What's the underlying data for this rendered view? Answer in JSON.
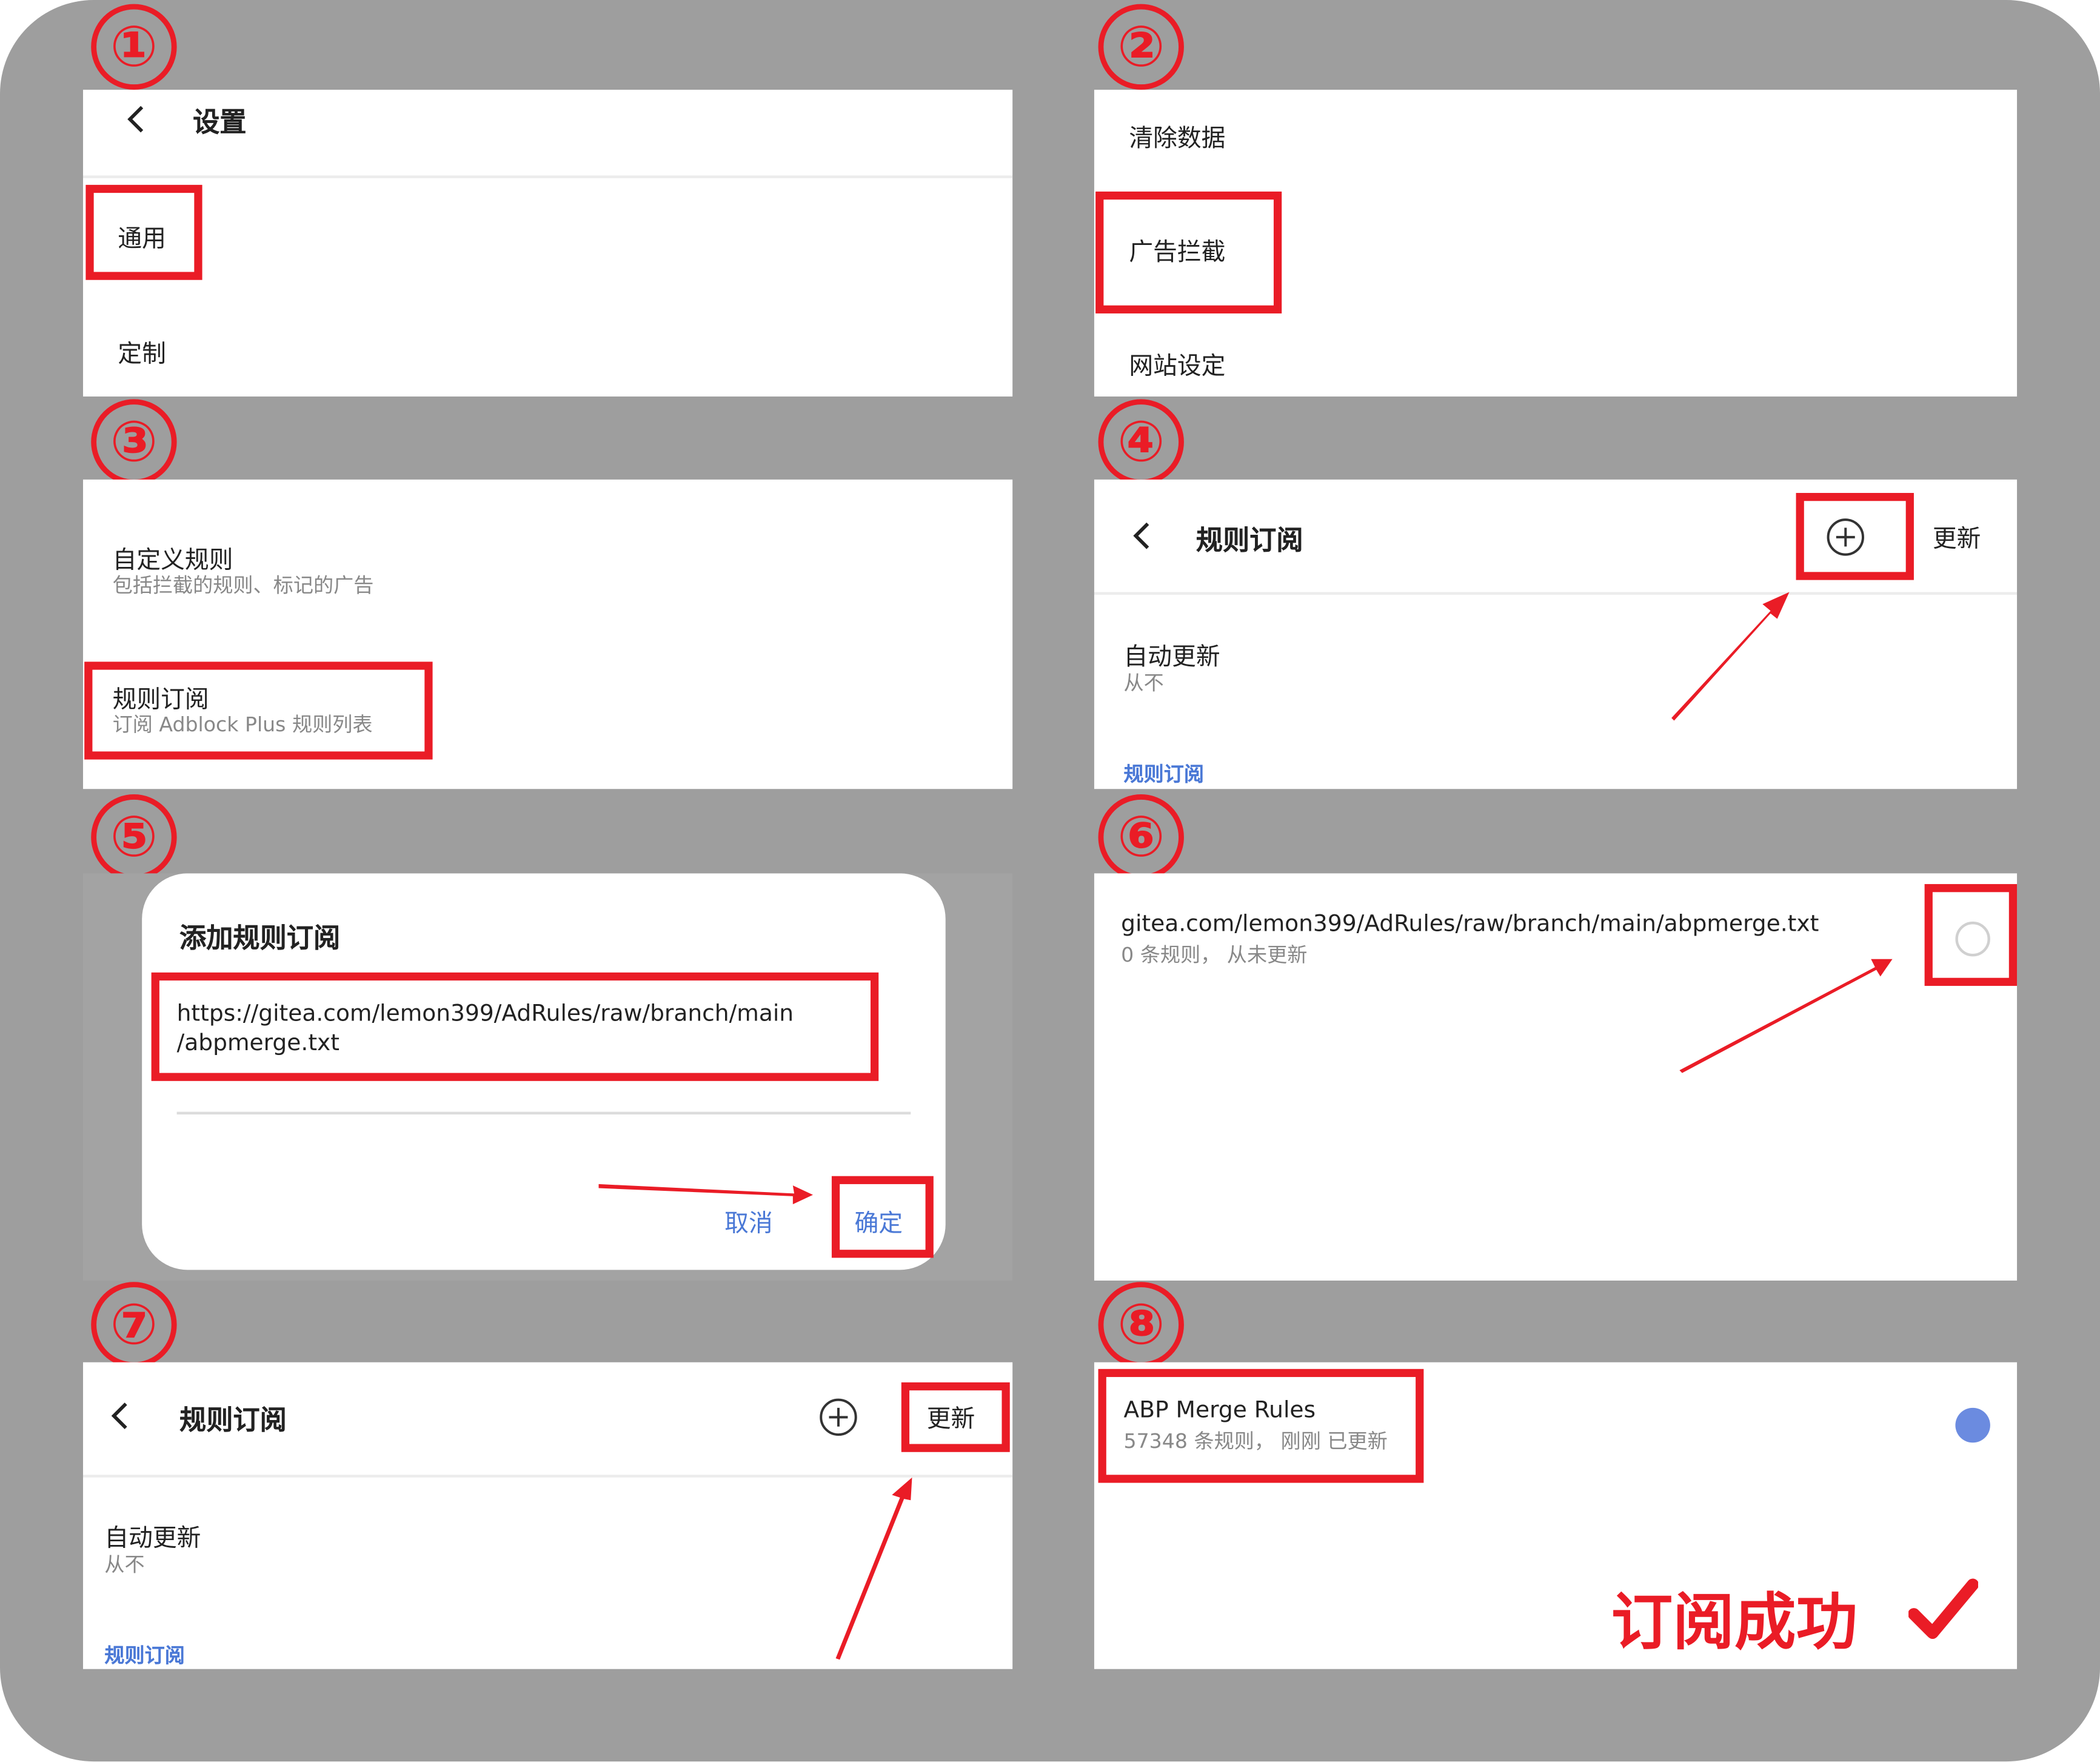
{
  "steps": [
    "①",
    "②",
    "③",
    "④",
    "⑤",
    "⑥",
    "⑦",
    "⑧"
  ],
  "panel1": {
    "title": "设置",
    "item_general": "通用",
    "item_custom": "定制"
  },
  "panel2": {
    "item_clear": "清除数据",
    "item_adblock": "广告拦截",
    "item_site": "网站设定"
  },
  "panel3": {
    "custom_rules": "自定义规则",
    "custom_rules_desc": "包括拦截的规则、标记的广告",
    "subscriptions": "规则订阅",
    "subscriptions_desc": "订阅 Adblock Plus 规则列表"
  },
  "panel4": {
    "title": "规则订阅",
    "update": "更新",
    "auto_update": "自动更新",
    "auto_update_value": "从不",
    "section": "规则订阅"
  },
  "panel5": {
    "dialog_title": "添加规则订阅",
    "url_line1": "https://gitea.com/lemon399/AdRules/raw/branch/main",
    "url_line2": "/abpmerge.txt",
    "cancel": "取消",
    "confirm": "确定"
  },
  "panel6": {
    "url": "gitea.com/lemon399/AdRules/raw/branch/main/abpmerge.txt",
    "status": "0 条规则， 从未更新"
  },
  "panel7": {
    "title": "规则订阅",
    "update": "更新",
    "auto_update": "自动更新",
    "auto_update_value": "从不",
    "section": "规则订阅"
  },
  "panel8": {
    "name": "ABP Merge Rules",
    "status": "57348 条规则， 刚刚 已更新",
    "success": "订阅成功"
  },
  "icons": [
    "back-arrow-icon",
    "add-circle-icon",
    "radio-unchecked-icon",
    "radio-checked-icon",
    "checkmark-icon",
    "red-arrow-icon"
  ],
  "colors": {
    "highlight": "#ea1c26",
    "accent": "#4a78d6",
    "background": "#9e9e9e"
  }
}
